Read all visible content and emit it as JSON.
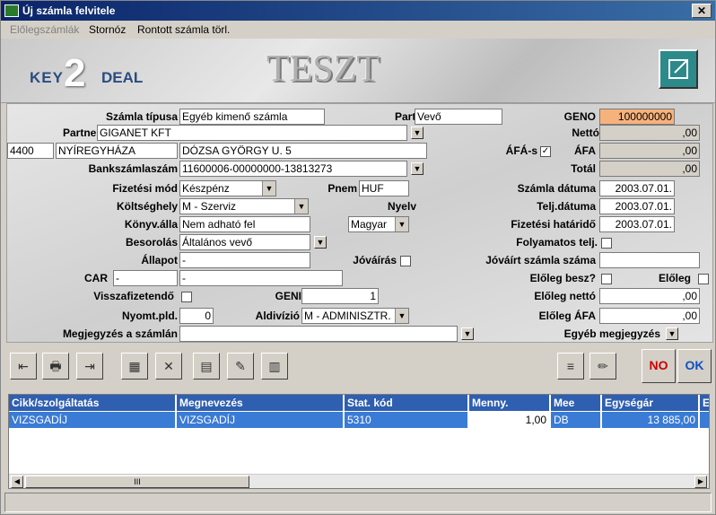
{
  "window": {
    "title": "Új számla felvitele",
    "close": "✕"
  },
  "menu": [
    "Előlegszámlák",
    "Stornóz",
    "Rontott számla törl."
  ],
  "header": {
    "logo_left": "KEY",
    "logo_mid": "2",
    "logo_right": "DEAL",
    "banner": "TESZT"
  },
  "form": {
    "szamla_tipusa_label": "Számla típusa",
    "szamla_tipusa": "Egyéb kimenő számla",
    "part_rel_label": "Part. rel.",
    "part_rel": "Vevő",
    "partner_label": "Partner",
    "partner": "GIGANET KFT",
    "irsz": "4400",
    "varos": "NYÍREGYHÁZA",
    "utca": "DÓZSA GYÖRGY U. 5",
    "bankszamla_label": "Bankszámlaszám",
    "bankszamla": "11600006-00000000-13813273",
    "fizmod_label": "Fizetési mód",
    "fizmod": "Készpénz",
    "pnem_label": "Pnem",
    "pnem": "HUF",
    "koltseghely_label": "Költséghely",
    "koltseghely": "M - Szerviz",
    "nyelv_label": "Nyelv",
    "nyelv": "Magyar",
    "konyv_label": "Könyv.álla",
    "konyv": "Nem adható fel",
    "besorolas_label": "Besorolás",
    "besorolas": "Általános vevő",
    "allapot_label": "Állapot",
    "allapot": "-",
    "jovairas_label": "Jóváírás",
    "car_label": "CAR",
    "car": "-",
    "car2": "-",
    "visszafizet_label": "Visszafizetendő",
    "geni_label": "GENI",
    "geni": "1",
    "nyomt_label": "Nyomt.pld.",
    "nyomt": "0",
    "aldivizio_label": "Aldivízió",
    "aldivizio": "M - ADMINISZTR.",
    "megjegyzes_label": "Megjegyzés a számlán",
    "geno_label": "GENO",
    "geno": "100000000",
    "netto_label": "Nettó",
    "netto": ",00",
    "afas_label": "ÁFÁ-s",
    "afa_label": "ÁFA",
    "afa": ",00",
    "total_label": "Totál",
    "total": ",00",
    "szamla_datum_label": "Számla dátuma",
    "szamla_datum": "2003.07.01.",
    "telj_datum_label": "Telj.dátuma",
    "telj_datum": "2003.07.01.",
    "fiz_hatarido_label": "Fizetési határidő",
    "fiz_hatarido": "2003.07.01.",
    "folyamatos_label": "Folyamatos telj.",
    "jovairt_label": "Jóváírt számla száma",
    "eloleg_besz_label": "Előleg besz?",
    "eloleg_label": "Előleg",
    "eloleg_netto_label": "Előleg nettó",
    "eloleg_netto": ",00",
    "eloleg_afa_label": "Előleg ÁFA",
    "eloleg_afa": ",00",
    "egyeb_megj_label": "Egyéb megjegyzés"
  },
  "buttons": {
    "no": "NO",
    "ok": "OK"
  },
  "grid": {
    "headers": [
      "Cikk/szolgáltatás",
      "Megnevezés",
      "Stat. kód",
      "Menny.",
      "Mee",
      "Egységár",
      "Er"
    ],
    "row": [
      "VIZSGADÍJ",
      "VIZSGADÍJ",
      "5310",
      "1,00",
      "DB",
      "13 885,00",
      ""
    ]
  },
  "scroll": {
    "thumb": "III"
  }
}
